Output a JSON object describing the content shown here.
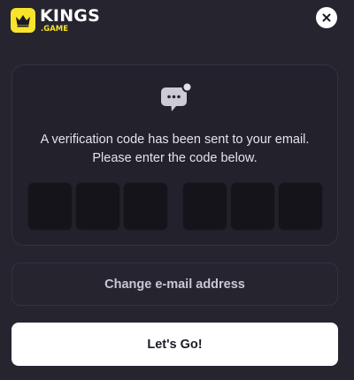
{
  "header": {
    "logo_main": "KINGS",
    "logo_sub": ".GAME",
    "close_icon": "close-icon"
  },
  "verification": {
    "icon": "chat-bubble-notification-icon",
    "message_line1": "A verification code has been sent to your email.",
    "message_line2": "Please enter the code below.",
    "code_digits": [
      "",
      "",
      "",
      "",
      "",
      ""
    ]
  },
  "actions": {
    "change_email_label": "Change e-mail address",
    "submit_label": "Let's Go!"
  },
  "colors": {
    "background": "#26242f",
    "brand_yellow": "#f8e42a",
    "code_box": "#15141b",
    "primary_button": "#ffffff"
  }
}
